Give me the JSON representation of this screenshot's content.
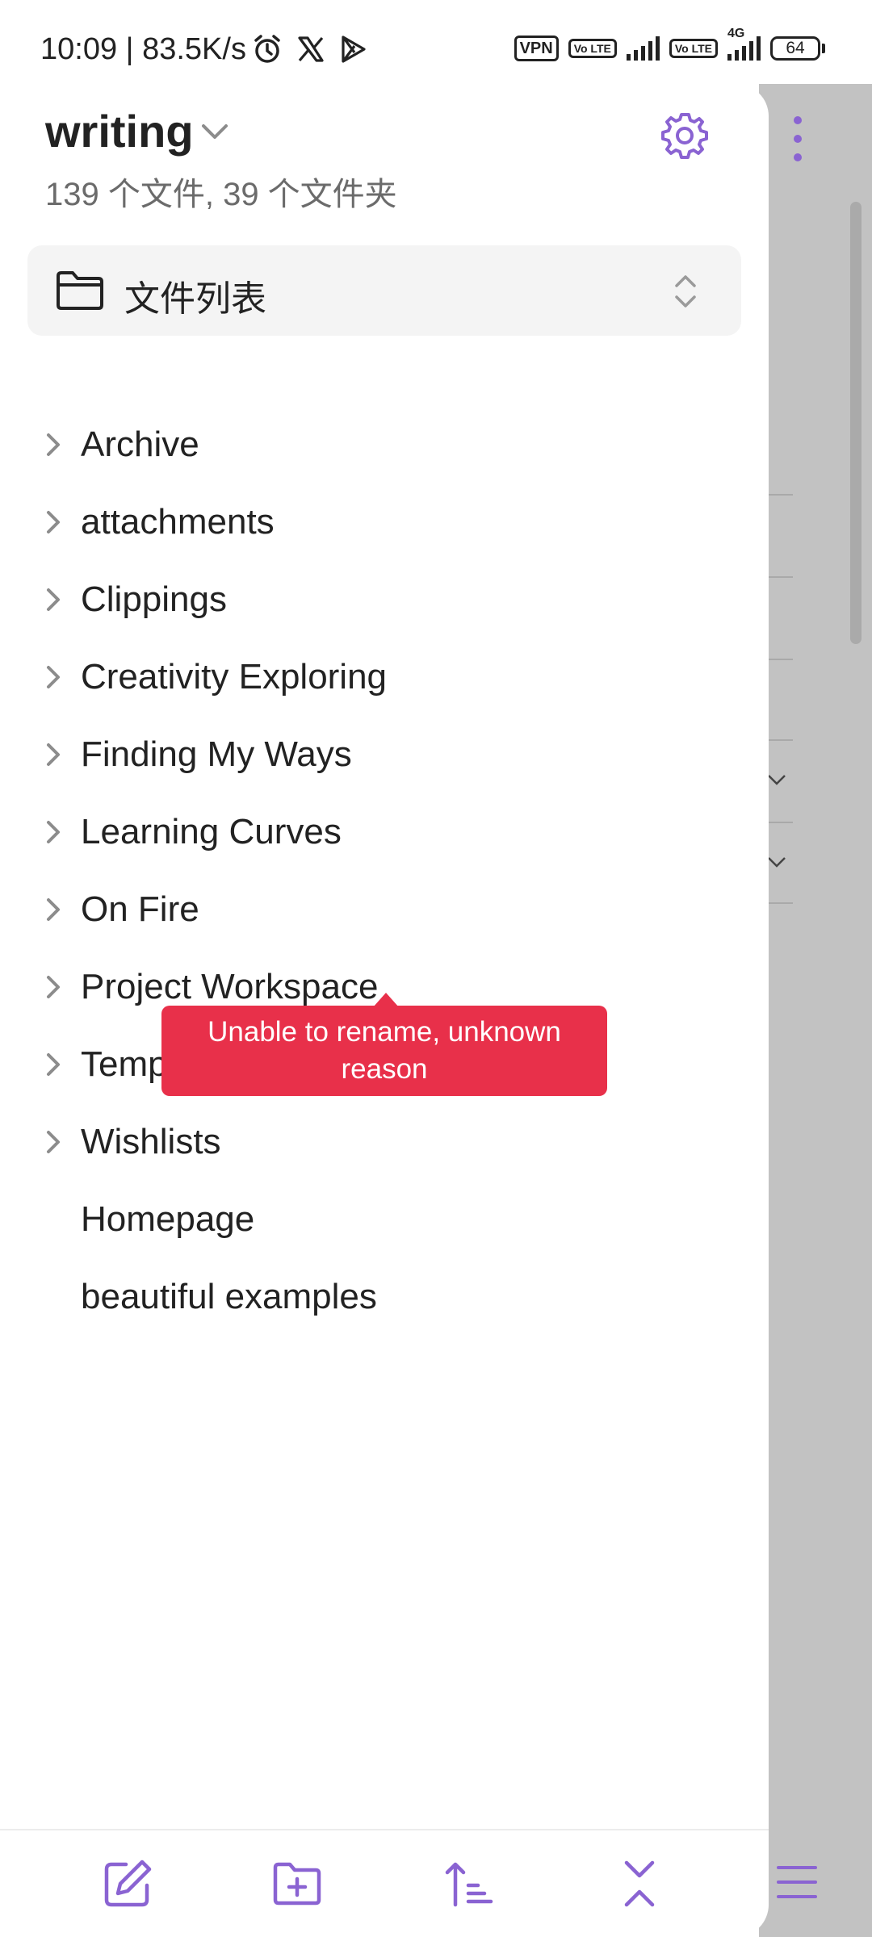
{
  "status_bar": {
    "time": "10:09 | 83.5K/s",
    "vpn": "VPN",
    "volte_1": "Vo LTE",
    "volte_2": "Vo LTE",
    "network": "4G",
    "battery": "64",
    "icons": [
      "alarm-icon",
      "x-icon",
      "play-icon"
    ]
  },
  "drawer": {
    "vault_name": "writing",
    "stats": "139 个文件, 39 个文件夹",
    "view_selector": {
      "label": "文件列表",
      "icon": "folder-icon"
    },
    "tree": [
      {
        "label": "Archive",
        "is_folder": true
      },
      {
        "label": "attachments",
        "is_folder": true
      },
      {
        "label": "Clippings",
        "is_folder": true
      },
      {
        "label": "Creativity Exploring",
        "is_folder": true
      },
      {
        "label": "Finding My Ways",
        "is_folder": true
      },
      {
        "label": "Learning Curves",
        "is_folder": true
      },
      {
        "label": "On Fire",
        "is_folder": true
      },
      {
        "label": "Project Workspace",
        "is_folder": true
      },
      {
        "label": "Temp",
        "is_folder": true
      },
      {
        "label": "Wishlists",
        "is_folder": true
      },
      {
        "label": "Homepage",
        "is_folder": false
      },
      {
        "label": "beautiful examples",
        "is_folder": false
      }
    ]
  },
  "toast": {
    "message": "Unable to rename, unknown reason"
  },
  "toolbar": {
    "items": [
      "new-note-icon",
      "new-folder-icon",
      "sort-icon",
      "collapse-all-icon"
    ]
  },
  "colors": {
    "accent": "#8a63d2",
    "toast_bg": "#e8304a",
    "dimmed_bg": "#c2c2c2",
    "text": "#222222",
    "muted_text": "#6b6b6b"
  }
}
